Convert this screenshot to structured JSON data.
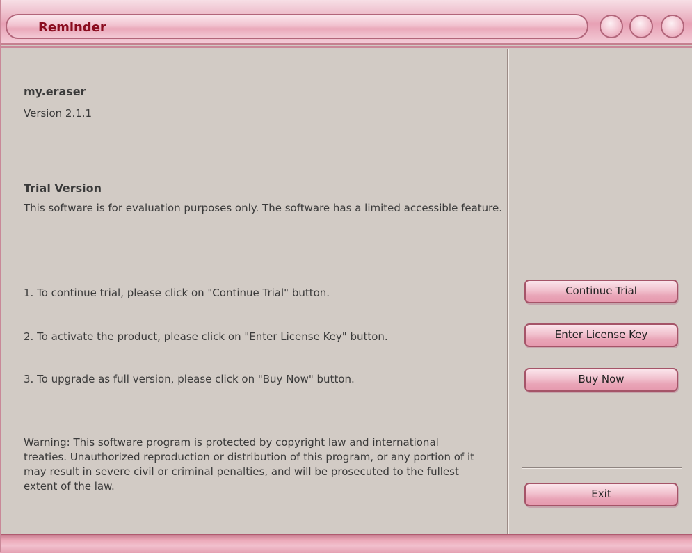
{
  "window": {
    "title": "Reminder"
  },
  "app": {
    "name": "my.eraser",
    "version": "Version 2.1.1"
  },
  "trial": {
    "heading": "Trial Version",
    "description": "This software is for evaluation purposes only. The software has a limited accessible feature."
  },
  "steps": [
    "1. To continue trial, please click on \"Continue Trial\" button.",
    "2. To activate the product, please click on \"Enter License Key\" button.",
    "3. To upgrade as full version, please click on \"Buy Now\" button."
  ],
  "warning": "Warning: This software program is protected by copyright law and international treaties. Unauthorized reproduction or distribution of this program, or any portion of it may result in severe civil or criminal penalties, and will be prosecuted to the fullest extent of the law.",
  "buttons": {
    "continue_trial": {
      "label": "Continue Trial"
    },
    "enter_license": {
      "label": "Enter License Key"
    },
    "buy_now": {
      "label": "Buy Now"
    },
    "exit": {
      "label": "Exit"
    }
  },
  "colors": {
    "title_text": "#8a0c1f",
    "accent_pink": "#e9a5b7",
    "panel_bg": "#d2cbc5"
  }
}
